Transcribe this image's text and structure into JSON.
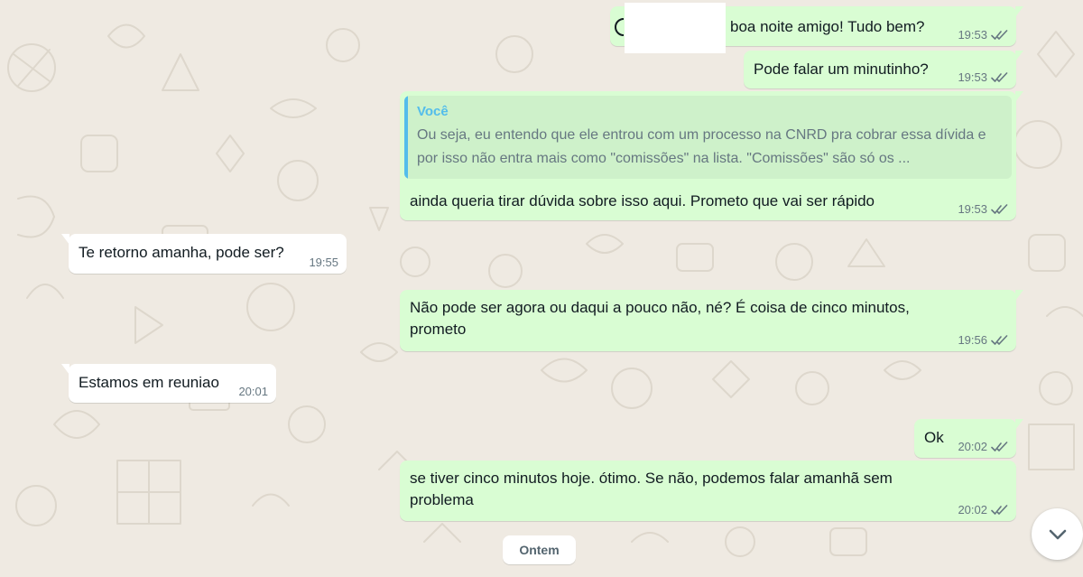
{
  "messages": [
    {
      "id": "m1",
      "direction": "out",
      "text": "boa noite amigo! Tudo bem?",
      "time": "19:53",
      "status_icon": "double-check-icon"
    },
    {
      "id": "m2",
      "direction": "out",
      "text": "Pode falar um minutinho?",
      "time": "19:53",
      "status_icon": "double-check-icon"
    },
    {
      "id": "m3",
      "direction": "out",
      "quote_author": "Você",
      "quote_text": "Ou seja, eu entendo que ele entrou com um processo na CNRD pra cobrar essa dívida e por isso não entra mais como \"comissões\" na lista. \"Comissões\" são só os ...",
      "text": "ainda queria tirar dúvida sobre isso aqui. Prometo que vai ser rápido",
      "time": "19:53",
      "status_icon": "double-check-icon"
    },
    {
      "id": "m4",
      "direction": "in",
      "text": "Te retorno amanha, pode ser?",
      "time": "19:55"
    },
    {
      "id": "m5",
      "direction": "out",
      "text": "Não pode ser agora ou daqui a pouco não, né? É coisa de cinco minutos, prometo",
      "time": "19:56",
      "status_icon": "double-check-icon"
    },
    {
      "id": "m6",
      "direction": "in",
      "text": "Estamos em reuniao",
      "time": "20:01"
    },
    {
      "id": "m7",
      "direction": "out",
      "text": "Ok",
      "time": "20:02",
      "status_icon": "double-check-icon"
    },
    {
      "id": "m8",
      "direction": "out",
      "text": "se tiver cinco minutos hoje. ótimo. Se não, podemos falar amanhã sem problema",
      "time": "20:02",
      "status_icon": "double-check-icon"
    }
  ],
  "date_divider": "Ontem",
  "scroll_button": {
    "icon": "chevron-down-icon"
  },
  "colors": {
    "background": "#efeae2",
    "outgoing_bubble": "#d9fdd3",
    "incoming_bubble": "#ffffff",
    "quote_accent": "#53bdeb",
    "meta_text": "#667781"
  }
}
